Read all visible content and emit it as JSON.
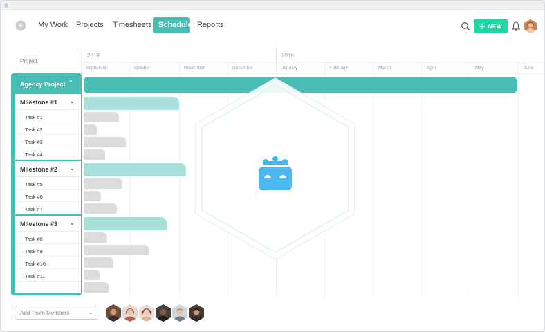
{
  "nav": {
    "items": [
      "My Work",
      "Projects",
      "Timesheets",
      "Schedule",
      "Reports"
    ],
    "active": "Schedule",
    "new_label": "NEW",
    "new_color": "#1ed8a4",
    "accent_color": "#47bdb6",
    "icons": [
      "logo-icon",
      "search-icon",
      "plus-icon",
      "bell-icon",
      "user-avatar"
    ]
  },
  "gantt": {
    "column_label": "Project",
    "years": [
      "2018",
      "2019"
    ],
    "months": [
      "September",
      "October",
      "November",
      "December",
      "January",
      "February",
      "March",
      "April",
      "May",
      "June"
    ],
    "project": {
      "name": "Agency Project"
    },
    "milestones": [
      {
        "name": "Milestone #1",
        "tasks": [
          "Task #1",
          "Task #2",
          "Task #3",
          "Task #4"
        ]
      },
      {
        "name": "Milestone #2",
        "tasks": [
          "Task #5",
          "Task #6",
          "Task #7"
        ]
      },
      {
        "name": "Milestone #3",
        "tasks": [
          "Task #8",
          "Task #9",
          "Task #10",
          "Task #11"
        ]
      }
    ]
  },
  "footer": {
    "team_placeholder": "Add Team Members",
    "members": [
      "member-avatar-1",
      "member-avatar-2",
      "member-avatar-3",
      "member-avatar-4",
      "member-avatar-5",
      "member-avatar-6"
    ]
  }
}
